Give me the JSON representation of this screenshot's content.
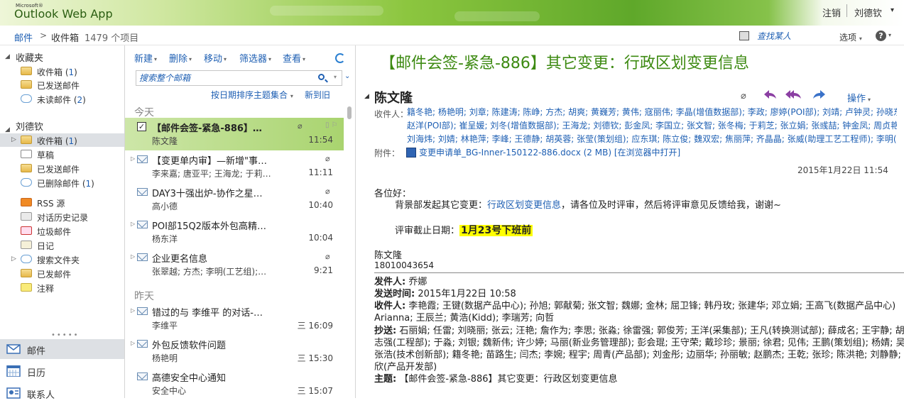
{
  "banner": {
    "ms_label": "Microsoft®",
    "app_name": "Outlook Web App",
    "signout": "注销",
    "user": "刘德钦"
  },
  "topbar": {
    "crumb_mail": "邮件",
    "crumb_folder": "收件箱",
    "item_count": "1479 个项目",
    "find_someone": "查找某人",
    "options": "选项",
    "help": "?"
  },
  "nav": {
    "favorites_title": "收藏夹",
    "favorites": [
      {
        "label": "收件箱",
        "count": "1"
      },
      {
        "label": "已发送邮件",
        "count": ""
      },
      {
        "label": "未读邮件",
        "count": "2"
      }
    ],
    "account_title": "刘德钦",
    "folders": [
      {
        "label": "收件箱",
        "count": "1"
      },
      {
        "label": "草稿",
        "count": ""
      },
      {
        "label": "已发送邮件",
        "count": ""
      },
      {
        "label": "已删除邮件",
        "count": "1"
      },
      {
        "label": "RSS 源",
        "count": ""
      },
      {
        "label": "对话历史记录",
        "count": ""
      },
      {
        "label": "垃圾邮件",
        "count": ""
      },
      {
        "label": "日记",
        "count": ""
      },
      {
        "label": "搜索文件夹",
        "count": ""
      },
      {
        "label": "已发邮件",
        "count": ""
      },
      {
        "label": "注释",
        "count": ""
      }
    ],
    "modules": [
      {
        "label": "邮件"
      },
      {
        "label": "日历"
      },
      {
        "label": "联系人"
      }
    ]
  },
  "toolbar": {
    "new": "新建",
    "delete": "删除",
    "move": "移动",
    "filter": "筛选器",
    "view": "查看"
  },
  "search": {
    "placeholder": "搜索整个邮箱"
  },
  "sort": {
    "by": "按日期排序主题集合",
    "order": "新到旧"
  },
  "groups": {
    "today": "今天",
    "yesterday": "昨天"
  },
  "messages": [
    {
      "subject": "【邮件会签-紧急-886】…",
      "from": "陈文隆",
      "time": "11:54"
    },
    {
      "subject": "【变更单内审】—新增\"事…",
      "from": "李来嘉; 唐亚平; 王海龙; 于莉…",
      "time": "11:11"
    },
    {
      "subject": "DAY3十强出炉-协作之星…",
      "from": "高小德",
      "time": "10:40"
    },
    {
      "subject": "POI部15Q2版本外包高精…",
      "from": "杨东洋",
      "time": "10:04"
    },
    {
      "subject": "企业更名信息",
      "from": "张翠越; 方杰; 李明(工艺组);…",
      "time": "9:21"
    },
    {
      "subject": "错过的与 李维平 的对话-…",
      "from": "李维平",
      "time": "三 16:09"
    },
    {
      "subject": "外包反馈软件问题",
      "from": "杨艳明",
      "time": "三 15:30"
    },
    {
      "subject": "高德安全中心通知",
      "from": "安全中心",
      "time": "三 15:07"
    }
  ],
  "reading": {
    "title": "【邮件会签-紧急-886】其它变更：行政区划变更信息",
    "sender": "陈文隆",
    "actions": "操作",
    "to_label": "收件人：",
    "recipients": [
      "籍冬艳; 杨艳明; 刘章; 陈建涛; 陈峥; 方杰; 胡爽; 黄巍芳; 黄伟; 寇丽伟; 李晶(增值数据部); 李政; 廖婷(POI部); 刘靖; 卢钟灵; 孙晓东; 孙",
      "赵洋(POI部); 崔呈媛; 刘冬(增值数据部); 王海龙; 刘德钦; 彭金凤; 李国立; 张文智; 张冬梅; 于莉芝; 张立娟; 张彧喆; 钟金凤; 周贞艳; 杨",
      "刘海炜; 刘婧; 林艳萍; 李峰; 王德静; 胡英蓉; 张莹(策划组); 应东琪; 陈立俊; 魏双宏; 焦丽萍; 齐晶晶; 张威(助理工艺工程师); 李明(工艺"
    ],
    "attach_label": "附件：",
    "attachment": "变更申请单_BG-Inner-150122-886.docx (2 MB)",
    "open_in_browser": "[在浏览器中打开]",
    "date": "2015年1月22日 11:54",
    "greeting": "各位好：",
    "body_pre": "背景部发起其它变更：",
    "body_link": "行政区划变更信息",
    "body_post": "，请各位及时评审，然后将评审意见反馈给我，谢谢~",
    "deadline_label": "评审截止日期：",
    "deadline": "1月23号下班前",
    "sig_name": "陈文隆",
    "sig_phone": "18010043654",
    "q_from_label": "发件人:",
    "q_from": " 乔娜",
    "q_sent_label": "发送时间:",
    "q_sent": " 2015年1月22日 10:58",
    "q_to_label": "收件人:",
    "q_to_1": " 李艳霞; 王键(数据产品中心); 孙旭; 郭献菊; 张文智; 魏娜; 金林; 屈卫锋; 韩丹玫; 张建华; 邓立娟; 王高飞(数据产品中心)",
    "q_to_2": "Arianna; 王辰兰; 黄浩(Kidd); 李瑞芳; 向哲",
    "q_cc_label": "抄送:",
    "q_cc_1": " 石丽娟; 任雷; 刘晓丽; 张云; 汪艳; 詹作为; 李思; 张淼; 徐雷强; 郭俊芳; 王洋(采集部); 王凡(转换测试部); 薛成名; 王宇静; 胡",
    "q_cc_2": "志强(工程部); 于淼; 刘银; 魏新伟; 许少婷; 马丽(新业务管理部); 彭会琨; 王守荣; 戴珍珍; 景丽; 徐君; 见伟; 王鹏(策划组); 杨婧; 吴",
    "q_cc_3": "张浩(技术创新部); 籍冬艳; 苗路生; 闫杰; 李婉; 程宇; 周青(产品部); 刘金彤; 边丽华; 孙丽敏; 赵鹏杰; 王乾; 张珍; 陈洪艳; 刘静静;",
    "q_cc_4": "欣(产品开发部)",
    "q_subj_label": "主题:",
    "q_subj": " 【邮件会签-紧急-886】其它变更：行政区划变更信息"
  },
  "colors": {
    "accent": "#1e5fb3",
    "title_green": "#3d8a12",
    "selected_row": "#a9d46f"
  }
}
